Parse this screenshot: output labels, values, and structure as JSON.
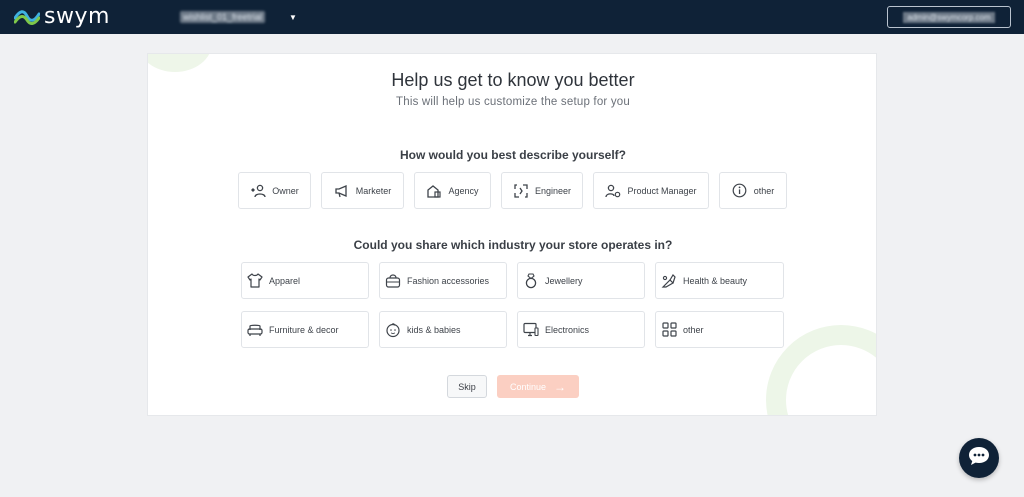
{
  "header": {
    "logo_text": "swym",
    "store_name": "wishlist_01_freetrial",
    "account_email": "admin@swymcorp.com",
    "bg_color": "#0f2237"
  },
  "onboarding": {
    "title": "Help us get to know you better",
    "subtitle": "This will help us customize the setup for you",
    "role_question": "How would you best describe yourself?",
    "roles": [
      {
        "label": "Owner",
        "icon": "owner-icon"
      },
      {
        "label": "Marketer",
        "icon": "megaphone-icon"
      },
      {
        "label": "Agency",
        "icon": "building-icon"
      },
      {
        "label": "Engineer",
        "icon": "code-icon"
      },
      {
        "label": "Product Manager",
        "icon": "user-gear-icon"
      },
      {
        "label": "other",
        "icon": "info-icon"
      }
    ],
    "industry_question": "Could you share which industry your store operates in?",
    "industries": [
      {
        "label": "Apparel",
        "icon": "tshirt-icon"
      },
      {
        "label": "Fashion accessories",
        "icon": "handbag-icon"
      },
      {
        "label": "Jewellery",
        "icon": "ring-icon"
      },
      {
        "label": "Health & beauty",
        "icon": "beauty-icon"
      },
      {
        "label": "Furniture & decor",
        "icon": "sofa-icon"
      },
      {
        "label": "kids & babies",
        "icon": "baby-icon"
      },
      {
        "label": "Electronics",
        "icon": "monitor-icon"
      },
      {
        "label": "other",
        "icon": "grid-icon"
      }
    ],
    "skip_label": "Skip",
    "continue_label": "Continue",
    "accent_color": "#fbcfc2"
  }
}
